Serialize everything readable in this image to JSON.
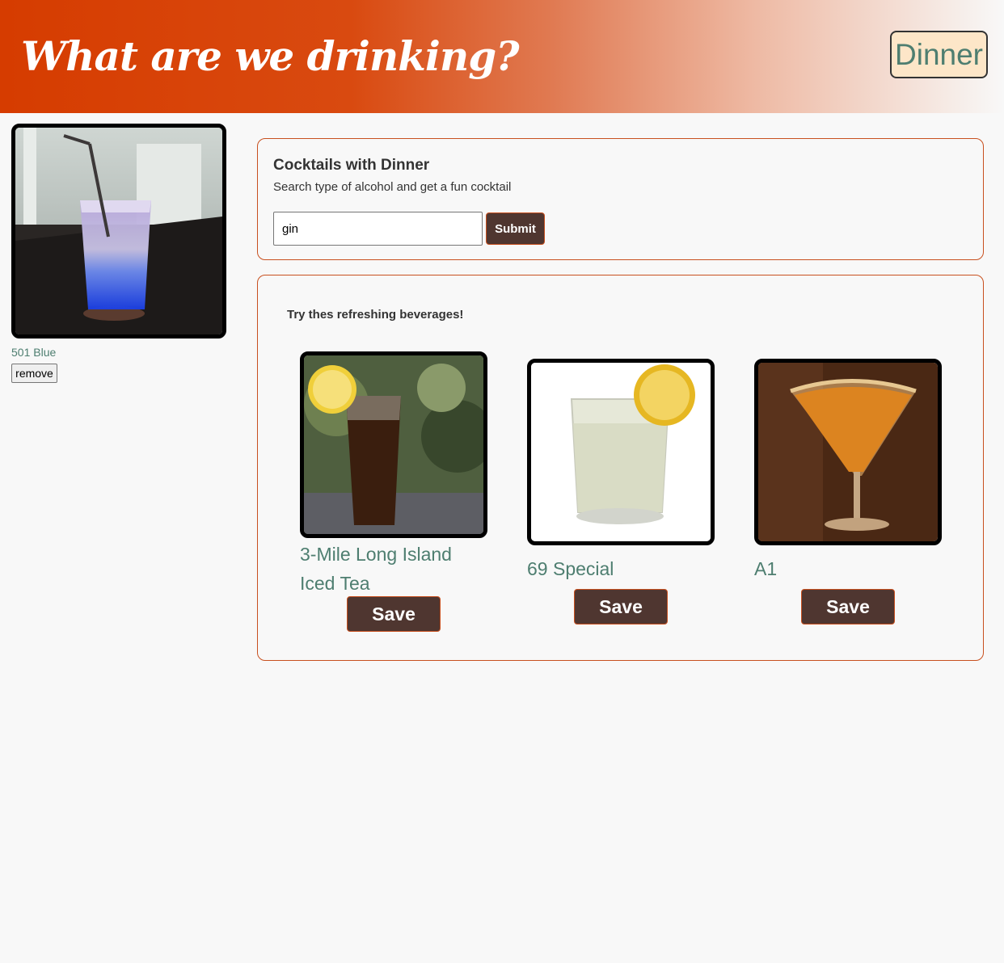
{
  "header": {
    "title": "What are we drinking?",
    "meal_button": "Dinner"
  },
  "saved": {
    "items": [
      {
        "name": "501 Blue",
        "image": "blue-cocktail-photo",
        "remove_label": "remove"
      }
    ]
  },
  "search": {
    "title": "Cocktails with Dinner",
    "subtitle": "Search type of alcohol and get a fun cocktail",
    "input_value": "gin",
    "submit_label": "Submit"
  },
  "results": {
    "heading": "Try thes refreshing beverages!",
    "drinks": [
      {
        "name": "3-Mile Long Island Iced Tea",
        "image": "iced-tea-photo",
        "save_label": "Save"
      },
      {
        "name": "69 Special",
        "image": "lemon-cocktail-photo",
        "save_label": "Save"
      },
      {
        "name": "A1",
        "image": "martini-photo",
        "save_label": "Save"
      }
    ]
  },
  "colors": {
    "header_start": "#d63c00",
    "accent_border": "#c8501f",
    "button_dark": "#4f3630",
    "name_text": "#4e7e70",
    "meal_button_bg": "#fde6c8"
  }
}
